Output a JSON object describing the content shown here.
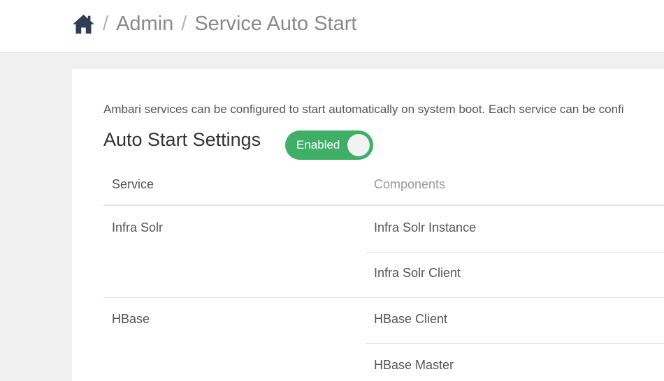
{
  "breadcrumb": {
    "home_icon": "home-icon",
    "separator": "/",
    "admin": "Admin",
    "current": "Service Auto Start"
  },
  "page": {
    "description": "Ambari services can be configured to start automatically on system boot. Each service can be confi",
    "section_title": "Auto Start Settings",
    "toggle": {
      "label": "Enabled",
      "state": "on",
      "color": "#3fae66"
    }
  },
  "table": {
    "headers": {
      "service": "Service",
      "components": "Components"
    },
    "services": [
      {
        "name": "Infra Solr",
        "components": [
          "Infra Solr Instance",
          "Infra Solr Client"
        ]
      },
      {
        "name": "HBase",
        "components": [
          "HBase Client",
          "HBase Master"
        ]
      }
    ]
  }
}
